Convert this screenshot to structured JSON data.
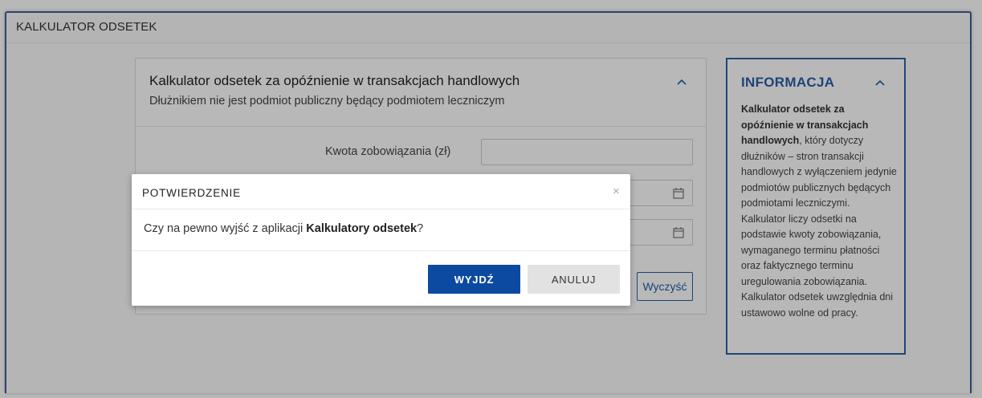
{
  "app": {
    "title": "KALKULATOR ODSETEK"
  },
  "calculator": {
    "title": "Kalkulator odsetek za opóźnienie w transakcjach handlowych",
    "subtitle": "Dłużnikiem nie jest podmiot publiczny będący podmiotem leczniczym",
    "amount_label": "Kwota zobowiązania (zł)",
    "amount_value": "",
    "clear_label": "Wyczyść",
    "collapse_icon": "chevron-up-icon"
  },
  "info": {
    "title": "INFORMACJA",
    "bold_intro": "Kalkulator odsetek za opóźnienie w transakcjach handlowych",
    "text": ", który dotyczy dłużników – stron transakcji handlowych z wyłączeniem jedynie podmiotów publicznych będących podmiotami leczniczymi. Kalkulator liczy odsetki na podstawie kwoty zobowiązania, wymaganego terminu płatności oraz faktycznego terminu uregulowania zobowiązania. Kalkulator odsetek uwzględnia dni ustawowo wolne od pracy.",
    "collapse_icon": "chevron-up-icon"
  },
  "modal": {
    "title": "POTWIERDZENIE",
    "close_glyph": "×",
    "body_prefix": "Czy na pewno wyjść z aplikacji ",
    "body_bold": "Kalkulatory odsetek",
    "body_suffix": "?",
    "confirm_label": "WYJDŹ",
    "cancel_label": "ANULUJ"
  },
  "colors": {
    "accent": "#0b4aa0",
    "frame_border": "#3d5f95",
    "info_title": "#2a5ea8"
  }
}
